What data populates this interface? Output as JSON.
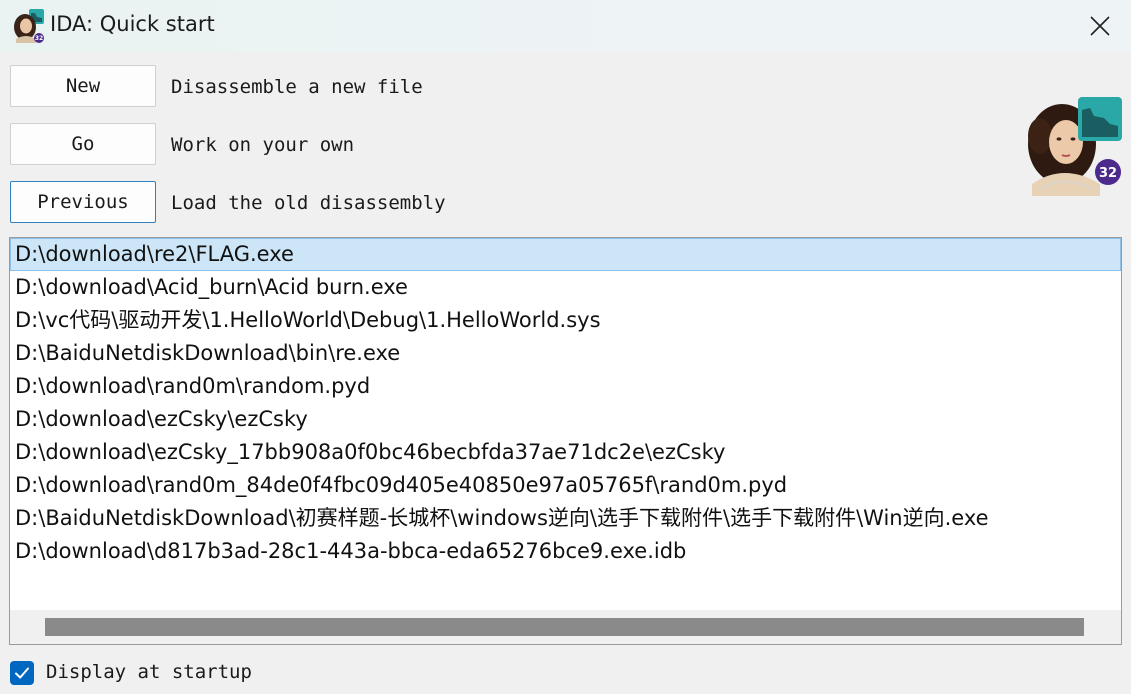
{
  "window": {
    "title": "IDA: Quick start"
  },
  "actions": {
    "new": {
      "label": "New",
      "description": "Disassemble a new file"
    },
    "go": {
      "label": "Go",
      "description": "Work on your own"
    },
    "previous": {
      "label": "Previous",
      "description": "Load the old disassembly"
    }
  },
  "recent_files": [
    "D:\\download\\re2\\FLAG.exe",
    "D:\\download\\Acid_burn\\Acid burn.exe",
    "D:\\vc代码\\驱动开发\\1.HelloWorld\\Debug\\1.HelloWorld.sys",
    "D:\\BaiduNetdiskDownload\\bin\\re.exe",
    "D:\\download\\rand0m\\random.pyd",
    "D:\\download\\ezCsky\\ezCsky",
    "D:\\download\\ezCsky_17bb908a0f0bc46becbfda37ae71dc2e\\ezCsky",
    "D:\\download\\rand0m_84de0f4fbc09d405e40850e97a05765f\\rand0m.pyd",
    "D:\\BaiduNetdiskDownload\\初赛样题-长城杯\\windows逆向\\选手下载附件\\选手下载附件\\Win逆向.exe",
    "D:\\download\\d817b3ad-28c1-443a-bbca-eda65276bce9.exe.idb"
  ],
  "selected_index": 0,
  "startup": {
    "label": "Display at startup",
    "checked": true
  },
  "logo": {
    "badge": "32"
  },
  "colors": {
    "accent": "#0067c0",
    "selection": "#cde6f7",
    "logo_tile": "#2aa8a8"
  }
}
